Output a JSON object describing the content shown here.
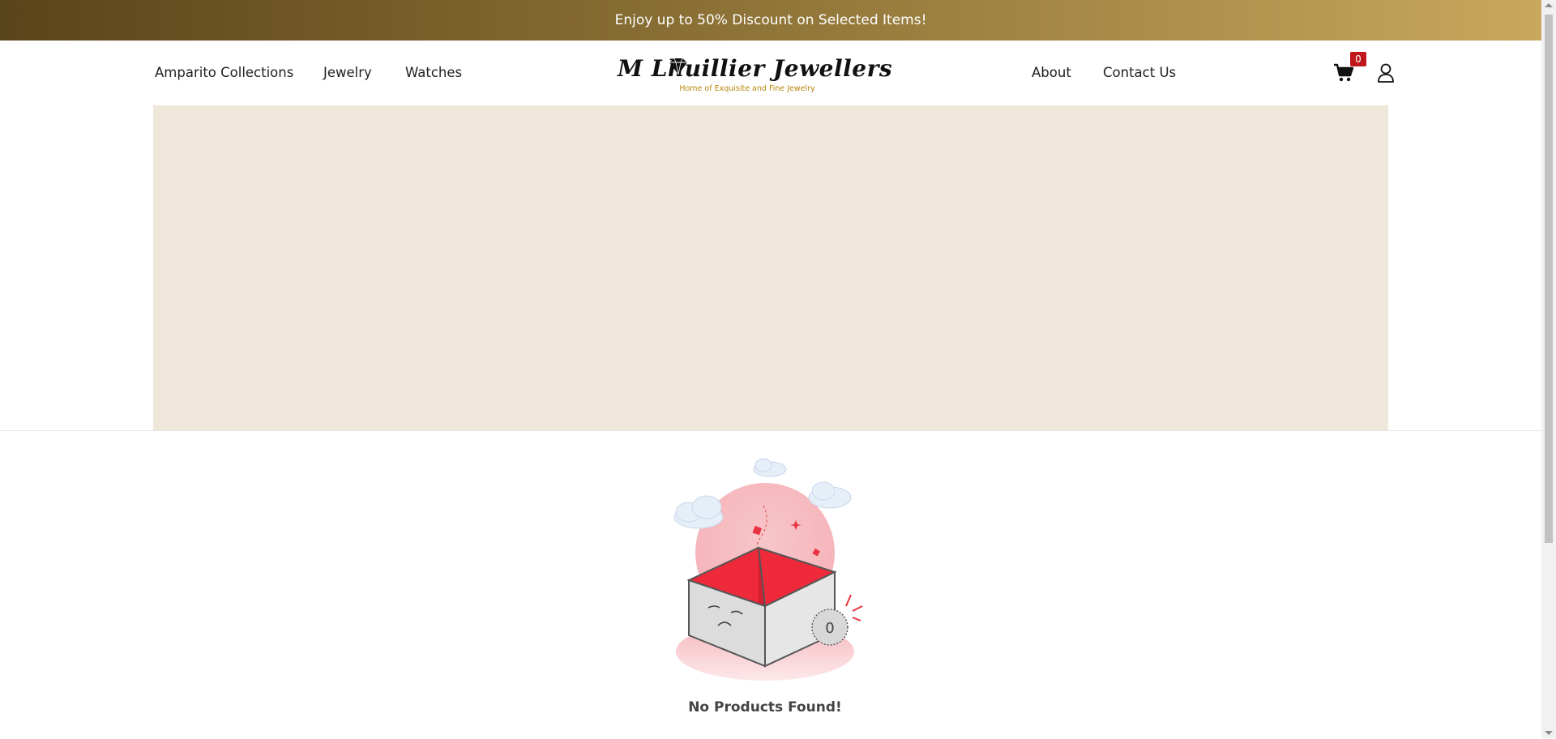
{
  "promo": {
    "text": "Enjoy up to 50% Discount on Selected Items!"
  },
  "nav_left": [
    {
      "label": "Amparito Collections"
    },
    {
      "label": "Jewelry"
    },
    {
      "label": "Watches"
    }
  ],
  "logo": {
    "name": "M Lhuillier Jewellers",
    "tagline": "Home of Exquisite and Fine Jewelry"
  },
  "nav_right": [
    {
      "label": "About"
    },
    {
      "label": "Contact Us"
    }
  ],
  "cart": {
    "count": "0",
    "icon": "cart-icon"
  },
  "account": {
    "icon": "user-icon"
  },
  "empty_state": {
    "message": "No Products Found!",
    "illustration_count": "0"
  },
  "colors": {
    "promo_start": "#5a4419",
    "promo_end": "#c8a85c",
    "banner": "#efe7da",
    "badge": "#c0171c",
    "accent_red": "#ee2a3a"
  }
}
